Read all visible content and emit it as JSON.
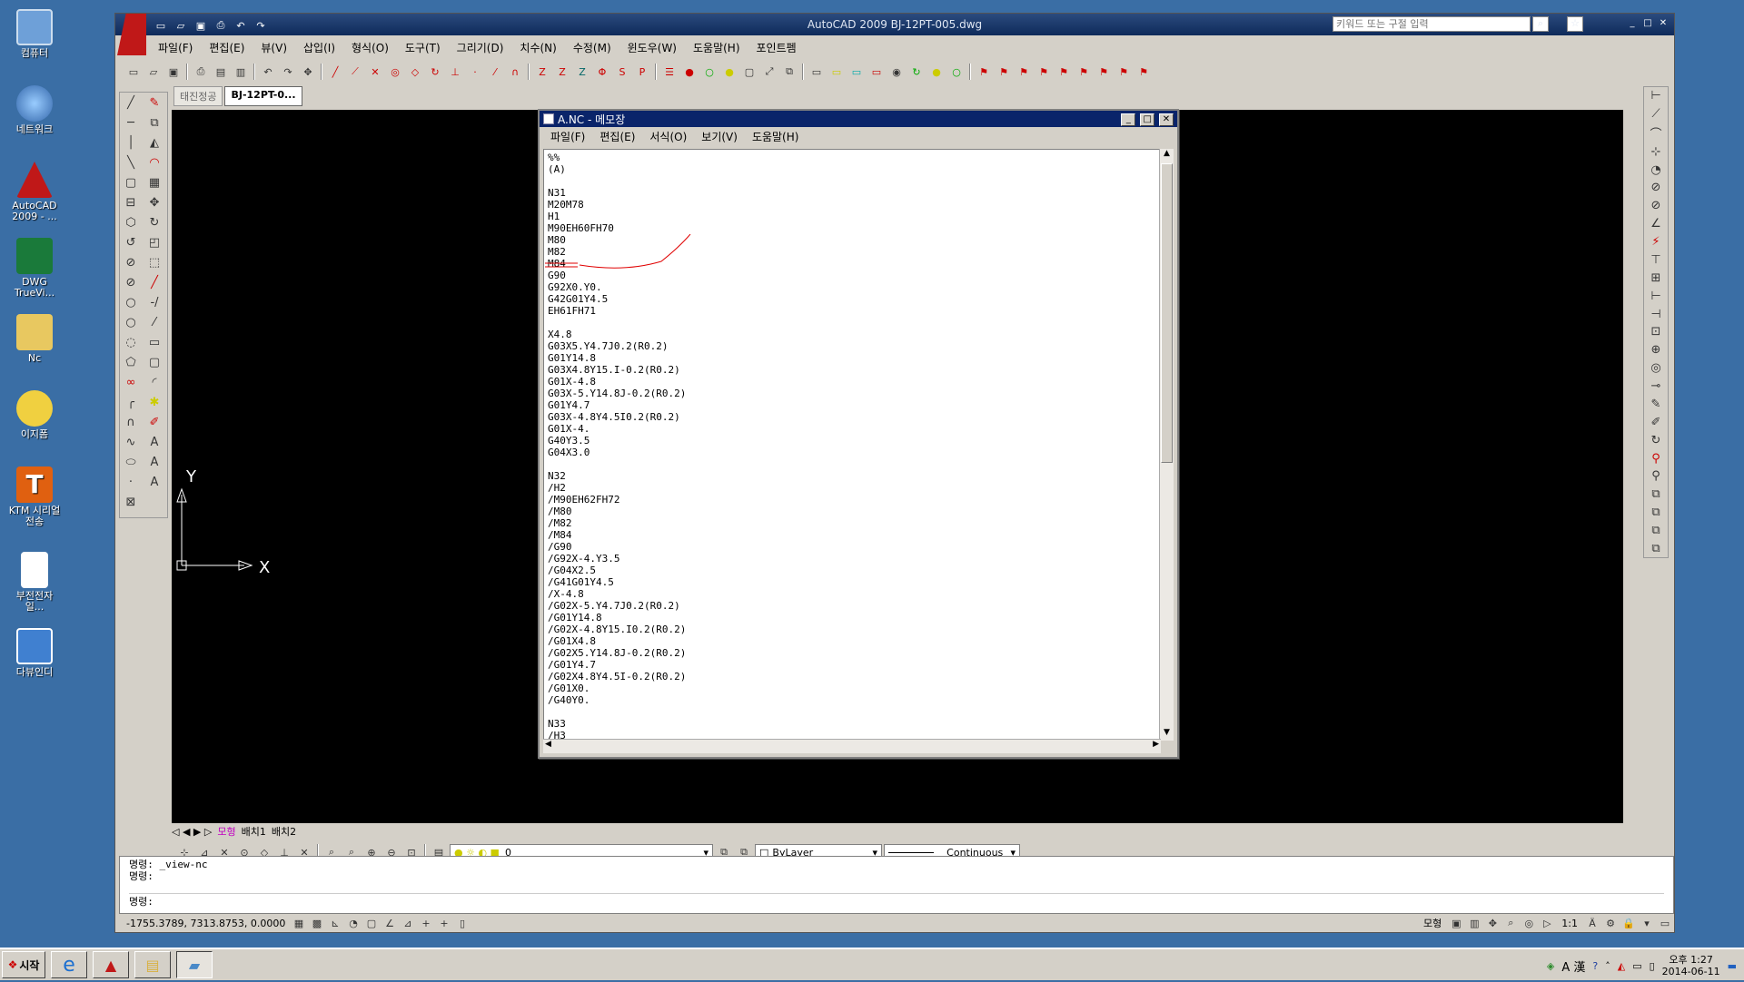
{
  "desktop": {
    "icons": [
      {
        "label": "컴퓨터",
        "icon": "computer-icon",
        "color": "#6ea0d8"
      },
      {
        "label": "네트워크",
        "icon": "network-icon",
        "color": "#4a90d0"
      },
      {
        "label": "AutoCAD 2009 - ...",
        "icon": "autocad-icon",
        "color": "#c01818"
      },
      {
        "label": "DWG TrueVi...",
        "icon": "dwg-trueview-icon",
        "color": "#1a7a3a"
      },
      {
        "label": "Nc",
        "icon": "folder-icon",
        "color": "#e8c860"
      },
      {
        "label": "이지폼",
        "icon": "easyform-icon",
        "color": "#f0d040"
      },
      {
        "label": "KTM 시리얼전송",
        "icon": "ktm-icon",
        "color": "#e06010"
      },
      {
        "label": "부전전자일...",
        "icon": "document-icon",
        "color": "#ffffff"
      },
      {
        "label": "다뷰인디",
        "icon": "daview-icon",
        "color": "#4080d0"
      }
    ]
  },
  "autocad": {
    "title": "AutoCAD 2009  BJ-12PT-005.dwg",
    "search_placeholder": "키워드 또는 구절 입력",
    "menus": [
      "파일(F)",
      "편집(E)",
      "뷰(V)",
      "삽입(I)",
      "형식(O)",
      "도구(T)",
      "그리기(D)",
      "치수(N)",
      "수정(M)",
      "윈도우(W)",
      "도움말(H)",
      "포인트펨"
    ],
    "doc_tabs": [
      "태진정공",
      "BJ-12PT-0..."
    ],
    "layout_tabs": [
      "모형",
      "배치1",
      "배치2"
    ],
    "layer_value": "0",
    "color_value": "ByLayer",
    "linetype_value": "Continuous",
    "ucs_y": "Y",
    "ucs_x": "X",
    "command_history": [
      "명령: _view-nc",
      "명령:"
    ],
    "command_prompt": "명령:",
    "coordinates": "-1755.3789, 7313.8753, 0.0000",
    "status_model": "모형",
    "status_scale": "1:1"
  },
  "notepad": {
    "title": "A.NC - 메모장",
    "menus": [
      "파일(F)",
      "편집(E)",
      "서식(O)",
      "보기(V)",
      "도움말(H)"
    ],
    "lines": [
      "%%",
      "(A)",
      "",
      "N31",
      "M20M78",
      "H1",
      "M90EH60FH70",
      "M80",
      "M82",
      "M84",
      "G90",
      "G92X0.Y0.",
      "G42G01Y4.5",
      "EH61FH71",
      "",
      "X4.8",
      "G03X5.Y4.7J0.2(R0.2)",
      "G01Y14.8",
      "G03X4.8Y15.I-0.2(R0.2)",
      "G01X-4.8",
      "G03X-5.Y14.8J-0.2(R0.2)",
      "G01Y4.7",
      "G03X-4.8Y4.5I0.2(R0.2)",
      "G01X-4.",
      "G40Y3.5",
      "G04X3.0",
      "",
      "N32",
      "/H2",
      "/M90EH62FH72",
      "/M80",
      "/M82",
      "/M84",
      "/G90",
      "/G92X-4.Y3.5",
      "/G04X2.5",
      "/G41G01Y4.5",
      "/X-4.8",
      "/G02X-5.Y4.7J0.2(R0.2)",
      "/G01Y14.8",
      "/G02X-4.8Y15.I0.2(R0.2)",
      "/G01X4.8",
      "/G02X5.Y14.8J-0.2(R0.2)",
      "/G01Y4.7",
      "/G02X4.8Y4.5I-0.2(R0.2)",
      "/G01X0.",
      "/G40Y0.",
      "",
      "N33",
      "/H3"
    ]
  },
  "taskbar": {
    "start_label": "시작",
    "tray_lang": "A 漢",
    "clock_time": "오후 1:27",
    "clock_date": "2014-06-11"
  },
  "colors": {
    "desktop": "#3a6ea5",
    "annotation_red": "#e00000",
    "title_active": "#0a246a"
  }
}
